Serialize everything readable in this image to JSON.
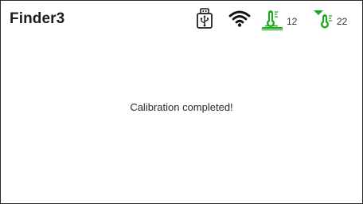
{
  "status_bar": {
    "device_name": "Finder3",
    "icons": {
      "usb": "usb-drive-icon",
      "wifi": "wifi-icon",
      "bed": "heated-bed-temperature-icon",
      "nozzle": "nozzle-temperature-icon"
    },
    "bed_temp": "12",
    "nozzle_temp": "22",
    "accent_color": "#1aaa1a"
  },
  "main": {
    "message": "Calibration completed!"
  }
}
